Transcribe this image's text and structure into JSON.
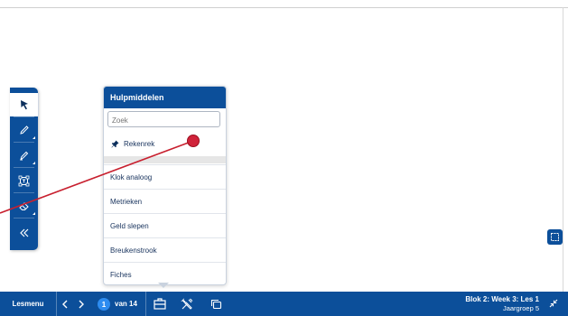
{
  "toolbar": {
    "tools": [
      {
        "name": "select-tool",
        "icon": "cursor-arrow-icon"
      },
      {
        "name": "pen-tool",
        "icon": "pencil-icon"
      },
      {
        "name": "marker-tool",
        "icon": "marker-icon"
      },
      {
        "name": "textbox-tool",
        "icon": "textbox-icon"
      },
      {
        "name": "eraser-tool",
        "icon": "eraser-icon"
      },
      {
        "name": "collapse-toolbar",
        "icon": "double-chevron-left-icon"
      }
    ]
  },
  "panel": {
    "title": "Hulpmiddelen",
    "search_placeholder": "Zoek",
    "pinned_item": "Rekenrek",
    "items": [
      "Klok analoog",
      "Metrieken",
      "Geld slepen",
      "Breukenstrook",
      "Fiches"
    ]
  },
  "bottom_bar": {
    "menu_label": "Lesmenu",
    "current_page": "1",
    "page_of": "van 14",
    "lesson_title": "Blok 2: Week 3: Les 1",
    "lesson_group": "Jaargroep 5"
  },
  "colors": {
    "primary": "#0c4f9a",
    "annotation": "#d0233a",
    "page_badge": "#2d8cf0"
  }
}
